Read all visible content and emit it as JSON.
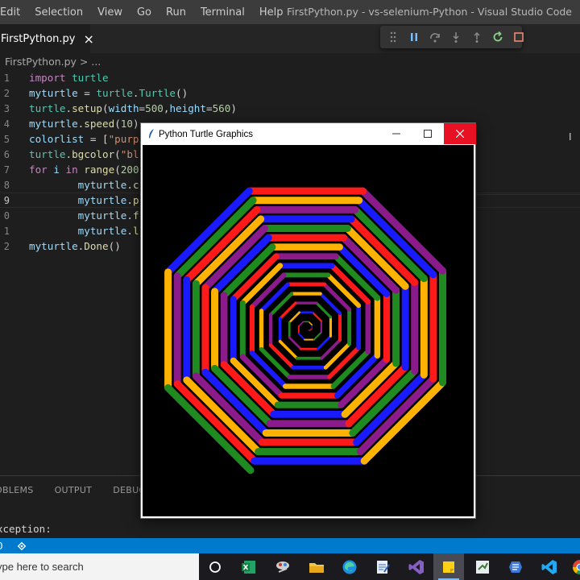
{
  "menu": [
    "Edit",
    "Selection",
    "View",
    "Go",
    "Run",
    "Terminal",
    "Help"
  ],
  "window_title": "FirstPython.py - vs-selenium-Python - Visual Studio Code",
  "tab": {
    "label": "FirstPython.py",
    "close": "×"
  },
  "breadcrumb": "FirstPython.py > ...",
  "editor": {
    "line_numbers": [
      "1",
      "2",
      "3",
      "4",
      "5",
      "6",
      "7",
      "8",
      "9",
      "0",
      "1",
      "2"
    ],
    "lines": [
      [
        [
          "kw",
          "import"
        ],
        [
          "plain",
          " "
        ],
        [
          "cls",
          "turtle"
        ]
      ],
      [
        [
          "var",
          "myturtle"
        ],
        [
          "plain",
          " = "
        ],
        [
          "cls",
          "turtle"
        ],
        [
          "plain",
          "."
        ],
        [
          "cls",
          "Turtle"
        ],
        [
          "plain",
          "()"
        ]
      ],
      [
        [
          "cls",
          "turtle"
        ],
        [
          "plain",
          "."
        ],
        [
          "fn",
          "setup"
        ],
        [
          "plain",
          "("
        ],
        [
          "var",
          "width"
        ],
        [
          "plain",
          "="
        ],
        [
          "num-lit",
          "500"
        ],
        [
          "plain",
          ","
        ],
        [
          "var",
          "height"
        ],
        [
          "plain",
          "="
        ],
        [
          "num-lit",
          "560"
        ],
        [
          "plain",
          ")"
        ]
      ],
      [
        [
          "var",
          "myturtle"
        ],
        [
          "plain",
          "."
        ],
        [
          "fn",
          "speed"
        ],
        [
          "plain",
          "("
        ],
        [
          "num-lit",
          "10"
        ],
        [
          "plain",
          ")"
        ]
      ],
      [
        [
          "var",
          "colorlist"
        ],
        [
          "plain",
          " = ["
        ],
        [
          "str",
          "\"purp"
        ]
      ],
      [
        [
          "cls",
          "turtle"
        ],
        [
          "plain",
          "."
        ],
        [
          "fn",
          "bgcolor"
        ],
        [
          "plain",
          "("
        ],
        [
          "str",
          "\"bl"
        ]
      ],
      [
        [
          "kw",
          "for"
        ],
        [
          "plain",
          " "
        ],
        [
          "var",
          "i"
        ],
        [
          "plain",
          " "
        ],
        [
          "kw",
          "in"
        ],
        [
          "plain",
          " "
        ],
        [
          "fn",
          "range"
        ],
        [
          "plain",
          "("
        ],
        [
          "num-lit",
          "200"
        ]
      ],
      [
        [
          "plain",
          "        "
        ],
        [
          "var",
          "myturtle"
        ],
        [
          "plain",
          "."
        ],
        [
          "fn",
          "c"
        ]
      ],
      [
        [
          "plain",
          "        "
        ],
        [
          "var",
          "myturtle"
        ],
        [
          "plain",
          "."
        ],
        [
          "fn",
          "p"
        ]
      ],
      [
        [
          "plain",
          "        "
        ],
        [
          "var",
          "myturtle"
        ],
        [
          "plain",
          "."
        ],
        [
          "fn",
          "f"
        ]
      ],
      [
        [
          "plain",
          "        "
        ],
        [
          "var",
          "myturtle"
        ],
        [
          "plain",
          "."
        ],
        [
          "fn",
          "l"
        ]
      ],
      [
        [
          "var",
          "myturtle"
        ],
        [
          "plain",
          "."
        ],
        [
          "fn",
          "Done"
        ],
        [
          "plain",
          "()"
        ]
      ]
    ]
  },
  "panel": {
    "tabs": [
      "OBLEMS",
      "OUTPUT",
      "DEBUG C"
    ],
    "output": "xception:"
  },
  "status": {
    "errors": "0"
  },
  "taskbar": {
    "search_placeholder": "ype here to search"
  },
  "turtle": {
    "title": "Python Turtle Graphics",
    "colors": [
      "#8b1a8b",
      "#ff1a1a",
      "#1a1aff",
      "#ffb300",
      "#1f8a1f"
    ]
  }
}
